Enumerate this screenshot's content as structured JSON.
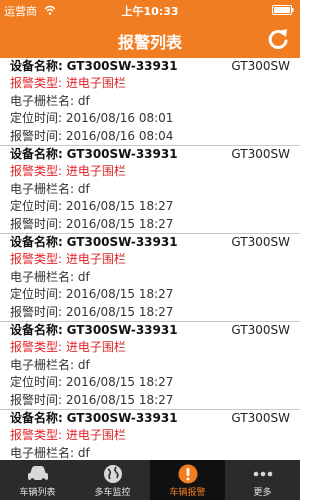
{
  "status_bar": {
    "carrier": "运营商",
    "time": "上午10:33"
  },
  "nav": {
    "title": "报警列表",
    "refresh_icon": "refresh-icon"
  },
  "colors": {
    "accent": "#f07d21",
    "alarm_type": "#e0262b",
    "tab_bar": "#2b2b2b"
  },
  "alarms": [
    {
      "device_label": "设备名称:",
      "device_name": "GT300SW-33931",
      "model": "GT300SW",
      "alarm_type": "报警类型: 进电子围栏",
      "fence_name": "电子栅栏名: df",
      "locate_time": "定位时间: 2016/08/16 08:01",
      "alarm_time": "报警时间: 2016/08/16 08:04"
    },
    {
      "device_label": "设备名称:",
      "device_name": "GT300SW-33931",
      "model": "GT300SW",
      "alarm_type": "报警类型: 进电子围栏",
      "fence_name": "电子栅栏名: df",
      "locate_time": "定位时间: 2016/08/15 18:27",
      "alarm_time": "报警时间: 2016/08/15 18:27"
    },
    {
      "device_label": "设备名称:",
      "device_name": "GT300SW-33931",
      "model": "GT300SW",
      "alarm_type": "报警类型: 进电子围栏",
      "fence_name": "电子栅栏名: df",
      "locate_time": "定位时间: 2016/08/15 18:27",
      "alarm_time": "报警时间: 2016/08/15 18:27"
    },
    {
      "device_label": "设备名称:",
      "device_name": "GT300SW-33931",
      "model": "GT300SW",
      "alarm_type": "报警类型: 进电子围栏",
      "fence_name": "电子栅栏名: df",
      "locate_time": "定位时间: 2016/08/15 18:27",
      "alarm_time": "报警时间: 2016/08/15 18:27"
    },
    {
      "device_label": "设备名称:",
      "device_name": "GT300SW-33931",
      "model": "GT300SW",
      "alarm_type": "报警类型: 进电子围栏",
      "fence_name": "电子栅栏名: df",
      "locate_time": "",
      "alarm_time": ""
    }
  ],
  "tabs": [
    {
      "label": "车辆列表",
      "icon": "car-icon",
      "active": false
    },
    {
      "label": "多车监控",
      "icon": "globe-icon",
      "active": false
    },
    {
      "label": "车辆报警",
      "icon": "alert-icon",
      "active": true
    },
    {
      "label": "更多",
      "icon": "more-icon",
      "active": false
    }
  ]
}
